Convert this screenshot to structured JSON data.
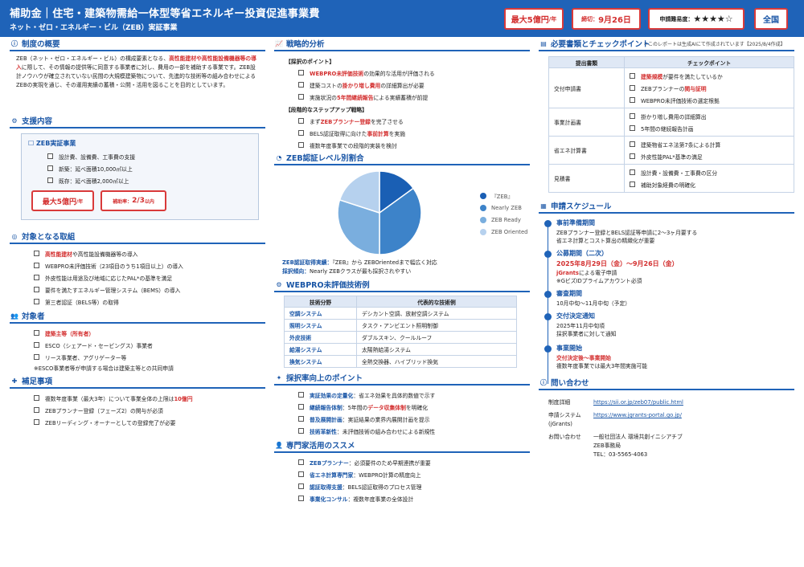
{
  "header": {
    "title": "補助金｜住宅・建築物需給一体型等省エネルギー投資促進事業費",
    "subtitle": "ネット・ゼロ・エネルギー・ビル（ZEB）実証事業",
    "badge_max_strong": "最大5億円",
    "badge_max_unit": "/年",
    "badge_deadline_label": "締切：",
    "badge_deadline_value": "9月26日",
    "badge_difficulty_label": "申請難易度：",
    "badge_difficulty_stars": "★★★★☆",
    "badge_area": "全国",
    "note": "＊このレポートは生成AIにて作成されています【2025/8/4作成】"
  },
  "overview": {
    "title": "制度の概要",
    "p1": "ZEB（ネット・ゼロ・エネルギー・ビル）の構成要素となる、",
    "p1_red": "高性能建材や高性能設備機器等の導入",
    "p2": "に際して、その情報の提供等に同意する事業者に対し、費用の一部を補助する事業です。ZEB設計ノウハウが確立されていない民間の大規模建築物について、先進的な技術等の組み合わせによるZEBの実現を通じ、その運用実績の蓄積・公開・活用を図ることを目的としています。"
  },
  "support": {
    "title": "支援内容",
    "box_title": "ZEB実証事業",
    "items": [
      "設計費、設備費、工事費の支援",
      "新築：延べ面積10,000㎡以上",
      "既存：延べ面積2,000㎡以上"
    ],
    "badge1_strong": "最大5億円",
    "badge1_unit": "/年",
    "badge2_label": "補助率：",
    "badge2_value": "2/3",
    "badge2_unit": "以内"
  },
  "target_actions": {
    "title": "対象となる取組",
    "item1_red": "高性能建材",
    "item1": "や高性能設備機器等の導入",
    "item2": "WEBPRO未評価技術（23項目のうち1項目以上）の導入",
    "item3": "外皮性能は用途及び地域に応じたPAL*の基準を満足",
    "item4": "要件を満たすエネルギー管理システム（BEMS）の導入",
    "item5": "第三者認証（BELS等）の取得"
  },
  "targets": {
    "title": "対象者",
    "item1_red": "建築主等（所有者）",
    "item2": "ESCO（シェアード・セービングス）事業者",
    "item3": "リース事業者、アグリゲーター等",
    "note": "※ESCO事業者等が申請する場合は建築主等との共同申請"
  },
  "supplement": {
    "title": "補足事項",
    "item1": "複数年度事業（最大3年）について事業全体の上限は",
    "item1_red": "10億円",
    "item2": "ZEBプランナー登録（フェーズ2）の関与が必須",
    "item3": "ZEBリーディング・オーナーとしての登録完了が必要"
  },
  "strategy": {
    "title": "戦略的分析",
    "h1": "【採択のポイント】",
    "a1_red": "WEBPRO未評価技術",
    "a1": "の効果的な活用が評価される",
    "a2_pre": "建築コストの",
    "a2_red": "掛かり増し費用",
    "a2": "の詳細算出が必要",
    "a3_pre": "実施状況の",
    "a3_red": "5年間継続報告",
    "a3": "による実績蓄積が前提",
    "h2": "【段階的なステップアップ戦略】",
    "b1_pre": "まず",
    "b1_red": "ZEBプランナー登録",
    "b1": "を完了させる",
    "b2_pre": "BELS認証取得に向けた",
    "b2_red": "事前計算",
    "b2": "を実施",
    "b3": "複数年度事業での段階的実装を検討"
  },
  "zeb_level": {
    "title": "ZEB認証レベル別割合",
    "result_label": "ZEB認証取得実績：",
    "result_text": "『ZEB』から ZEBOrientedまで幅広く対応",
    "trend_label": "採択傾向：",
    "trend_text": "Nearly ZEBクラスが最も採択されやすい"
  },
  "chart_data": {
    "type": "pie",
    "categories": [
      "『ZEB』",
      "Nearly ZEB",
      "ZEB Ready",
      "ZEB Oriented"
    ],
    "values": [
      15,
      35,
      30,
      20
    ],
    "colors": [
      "#1a5fb4",
      "#3d83c9",
      "#7aaede",
      "#b6d1ee"
    ],
    "legend": "right"
  },
  "webpro": {
    "title": "WEBPRO未評価技術例",
    "headers": [
      "技術分野",
      "代表的な技術例"
    ],
    "rows": [
      [
        "空調システム",
        "デシカント空調、放射空調システム"
      ],
      [
        "照明システム",
        "タスク・アンビエント照明制御"
      ],
      [
        "外皮技術",
        "ダブルスキン、クールルーフ"
      ],
      [
        "給湯システム",
        "太陽熱給湯システム"
      ],
      [
        "換気システム",
        "全熱交換器、ハイブリッド換気"
      ]
    ]
  },
  "improve": {
    "title": "採択率向上のポイント",
    "l1": "実証効果の定量化",
    "t1": "：省エネ効果を具体的数値で示す",
    "l2": "継続報告体制",
    "t2_pre": "：5年間の",
    "t2_red": "データ収集体制",
    "t2": "を明確化",
    "l3": "普及展開計画",
    "t3": "：実証結果の業界内展開計画を提示",
    "l4": "技術革新性",
    "t4": "：未評価技術の組み合わせによる新規性"
  },
  "experts": {
    "title": "専門家活用のススメ",
    "l1": "ZEBプランナー",
    "t1": "：必須要件のため早期連携が重要",
    "l2": "省エネ計算専門家",
    "t2": "：WEBPRO計算の精度向上",
    "l3": "認証取得支援",
    "t3": "：BELS認証取得のプロセス管理",
    "l4": "事業化コンサル",
    "t4": "：複数年度事業の全体設計"
  },
  "documents": {
    "title": "必要書類とチェックポイント",
    "headers": [
      "提出書類",
      "チェックポイント"
    ],
    "rows": [
      {
        "doc": "交付申請書",
        "c1_red": "建築規模",
        "c1": "が要件を満たしているか",
        "c2": "ZEBプランナーの",
        "c2_red": "関与証明",
        "c3": "WEBPRO未評価技術の選定根拠"
      },
      {
        "doc": "事業計画書",
        "c1": "掛かり増し費用の詳細算出",
        "c2": "5年間の継続報告計画"
      },
      {
        "doc": "省エネ計算書",
        "c1": "建築物省エネ法第7条による計算",
        "c2": "外皮性能PAL*基準の満足"
      },
      {
        "doc": "見積書",
        "c1": "設計費・設備費・工事費の区分",
        "c2": "補助対象経費の明確化"
      }
    ]
  },
  "schedule": {
    "title": "申請スケジュール",
    "s1_title": "事前準備期間",
    "s1_t1": "ZEBプランナー登録とBELS認証等申請に2〜3ヶ月要する",
    "s1_t2": "省エネ計算とコスト算出の精緻化が重要",
    "s2_title": "公募期間（二次）",
    "s2_date": "2025年8月29日（金）〜9月26日（金）",
    "s2_t1_red": "jGrants",
    "s2_t1": "による電子申請",
    "s2_t2": "※GビズIDプライムアカウント必須",
    "s3_title": "審査期間",
    "s3_t1": "10月中旬〜11月中旬（予定）",
    "s4_title": "交付決定通知",
    "s4_t1": "2025年11月中旬頃",
    "s4_t2": "採択事業者に対して通知",
    "s5_title": "事業開始",
    "s5_t1_red": "交付決定後〜事業開始",
    "s5_t2": "複数年度事業では最大3年間実施可能"
  },
  "contact": {
    "title": "問い合わせ",
    "l1": "制度詳細",
    "v1": "https://sii.or.jp/zeb07/public.html",
    "l2a": "申請システム",
    "l2b": "(jGrants)",
    "v2": "https://www.jgrants-portal.go.jp/",
    "l3": "お問い合わせ",
    "v3a": "一般社団法人 環境共創イニシアチブ",
    "v3b": "ZEB事務局",
    "v3c": "TEL：03-5565-4063"
  }
}
